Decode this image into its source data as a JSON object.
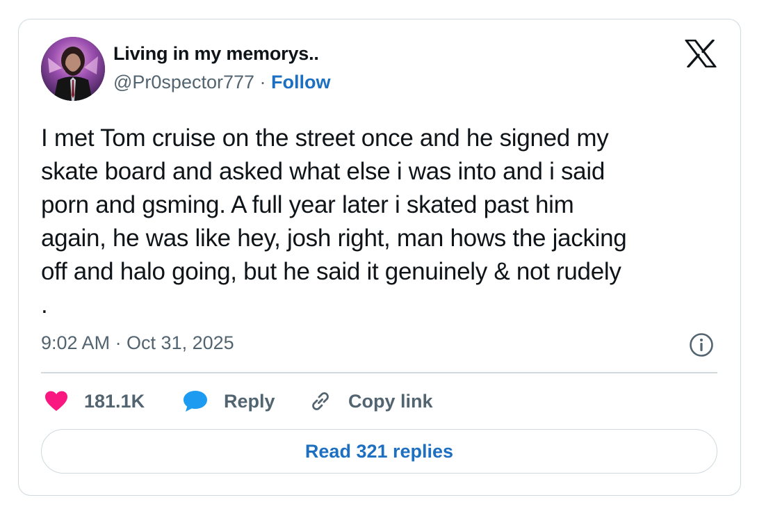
{
  "author": {
    "display_name": "Living in my memorys..",
    "handle": "@Pr0spector777",
    "separator": " · ",
    "follow_label": "Follow"
  },
  "tweet": {
    "text": "I met Tom cruise on the street once and he signed my\nskate board and asked what else i was into and i said\nporn and gsming. A full year later i skated past him\nagain, he was like hey, josh right, man hows the jacking\noff and halo going, but he said it genuinely & not rudely\n.",
    "timestamp": "9:02 AM · Oct 31, 2025"
  },
  "actions": {
    "like_count": "181.1K",
    "reply_label": "Reply",
    "copy_link_label": "Copy link"
  },
  "footer": {
    "read_replies_label": "Read 321 replies"
  },
  "icons": {
    "brand": "x-logo-icon",
    "info": "info-icon",
    "like": "heart-icon",
    "reply": "speech-bubble-icon",
    "copy": "link-icon"
  },
  "colors": {
    "text_primary": "#0f1419",
    "text_secondary": "#536471",
    "link": "#1d6fc2",
    "heart": "#f91880",
    "reply_bubble": "#1d9bf0",
    "border": "#cfd9de"
  }
}
